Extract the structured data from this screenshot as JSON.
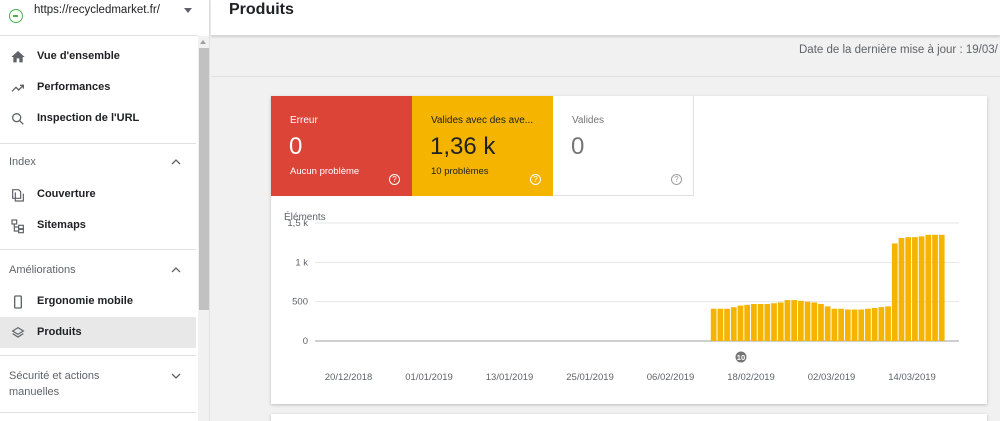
{
  "property": {
    "url": "https://recycledmarket.fr/"
  },
  "nav": {
    "overview": "Vue d'ensemble",
    "performance": "Performances",
    "url_inspection": "Inspection de l'URL",
    "index_section": "Index",
    "coverage": "Couverture",
    "sitemaps": "Sitemaps",
    "enhancements_section": "Améliorations",
    "mobile": "Ergonomie mobile",
    "products": "Produits",
    "security_section_line1": "Sécurité et actions",
    "security_section_line2": "manuelles"
  },
  "page": {
    "title": "Produits",
    "last_update": "Date de la dernière mise à jour : 19/03/"
  },
  "tiles": {
    "error": {
      "label": "Erreur",
      "value": "0",
      "sub": "Aucun problème",
      "color": "#db4437"
    },
    "warning": {
      "label": "Valides avec des ave...",
      "value": "1,36 k",
      "sub": "10 problèmes",
      "color": "#f4b400"
    },
    "valid": {
      "label": "Valides",
      "value": "0"
    }
  },
  "icons": {
    "overview": "home-icon",
    "performance": "trending-up-icon",
    "url_inspection": "search-icon",
    "coverage": "file-copy-icon",
    "sitemaps": "sitemap-icon",
    "mobile": "smartphone-icon",
    "products": "layers-icon",
    "help": "help-circle-icon",
    "section_toggle": "chevron-icon"
  },
  "chart_data": {
    "type": "bar",
    "ylabel": "Éléments",
    "y_ticks": [
      "1,5 k",
      "1 k",
      "500",
      "0"
    ],
    "ylim": [
      0,
      1500
    ],
    "x_ticks": [
      "20/12/2018",
      "01/01/2019",
      "13/01/2019",
      "25/01/2019",
      "06/02/2019",
      "18/02/2019",
      "02/03/2019",
      "14/03/2019"
    ],
    "x_start": "2018-12-15",
    "x_end": "2019-03-21",
    "bar_color": "#f4b400",
    "series": [
      {
        "dates": [
          "2019-02-12",
          "2019-02-13",
          "2019-02-14",
          "2019-02-15",
          "2019-02-16",
          "2019-02-17",
          "2019-02-18",
          "2019-02-19",
          "2019-02-20",
          "2019-02-21",
          "2019-02-22",
          "2019-02-23",
          "2019-02-24",
          "2019-02-25",
          "2019-02-26",
          "2019-02-27",
          "2019-02-28",
          "2019-03-01",
          "2019-03-02",
          "2019-03-03",
          "2019-03-04",
          "2019-03-05",
          "2019-03-06",
          "2019-03-07",
          "2019-03-08",
          "2019-03-09",
          "2019-03-10",
          "2019-03-11",
          "2019-03-12",
          "2019-03-13",
          "2019-03-14",
          "2019-03-15",
          "2019-03-16",
          "2019-03-17",
          "2019-03-18"
        ],
        "values": [
          410,
          410,
          410,
          430,
          450,
          460,
          470,
          470,
          470,
          480,
          490,
          520,
          520,
          510,
          500,
          490,
          470,
          440,
          410,
          410,
          400,
          400,
          400,
          410,
          420,
          430,
          440,
          1240,
          1310,
          1320,
          1320,
          1330,
          1350,
          1350,
          1350
        ]
      }
    ],
    "annotations": [
      {
        "date": "2019-02-16",
        "label": "10"
      }
    ]
  }
}
